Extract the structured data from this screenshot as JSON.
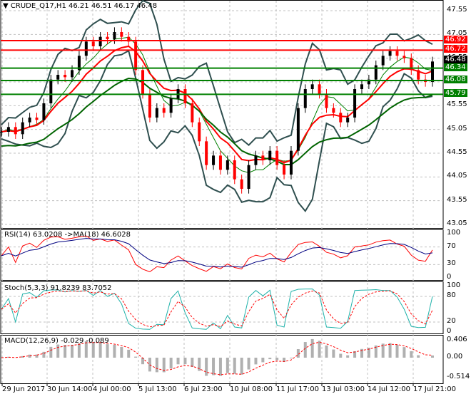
{
  "header": {
    "symbol": "CRUDE_Q17,H1",
    "ohlc": "46.21 46.51 46.17 46.48"
  },
  "price_axis": {
    "ticks": [
      "47.55",
      "47.05",
      "46.55",
      "46.05",
      "45.55",
      "45.05",
      "44.55",
      "44.05",
      "43.55",
      "43.05"
    ],
    "max": 47.55,
    "min": 43.05
  },
  "levels": [
    {
      "label": "46.92",
      "value": 46.92,
      "color": "#ff0000"
    },
    {
      "label": "46.72",
      "value": 46.72,
      "color": "#ff0000"
    },
    {
      "label": "46.34",
      "value": 46.34,
      "color": "#008000"
    },
    {
      "label": "46.08",
      "value": 46.08,
      "color": "#008000"
    },
    {
      "label": "45.79",
      "value": 45.79,
      "color": "#008000"
    }
  ],
  "current_price": {
    "label": "46.48",
    "value": 46.48
  },
  "rsi": {
    "title": "RSI(14) 63.0208  ->MA(18) 46.6028",
    "ticks": [
      "100",
      "70",
      "30",
      "0"
    ]
  },
  "stoch": {
    "title": "Stoch(5,3,3) 91.8239 83.7052",
    "ticks": [
      "100",
      "80",
      "20",
      "0"
    ]
  },
  "macd": {
    "title": "MACD(12,26,9) -0.029 -0.089",
    "ticks": [
      "0.406",
      "0.00",
      "-0.514"
    ]
  },
  "time_axis": [
    "29 Jun 2017",
    "30 Jun 14:00",
    "4 Jul 00:00",
    "5 Jul 13:00",
    "6 Jul 23:00",
    "10 Jul 08:00",
    "11 Jul 17:00",
    "13 Jul 03:00",
    "14 Jul 12:00",
    "17 Jul 21:00"
  ],
  "chart_data": {
    "type": "candlestick",
    "closes": [
      45.0,
      45.1,
      44.95,
      45.2,
      45.3,
      45.25,
      45.6,
      46.1,
      46.2,
      46.15,
      46.3,
      46.6,
      46.9,
      46.8,
      47.0,
      46.95,
      47.1,
      47.0,
      46.9,
      46.3,
      45.8,
      45.3,
      45.5,
      45.4,
      45.7,
      45.9,
      45.6,
      45.2,
      44.8,
      44.3,
      44.5,
      44.2,
      44.4,
      44.0,
      43.8,
      44.3,
      44.5,
      44.4,
      44.6,
      44.3,
      44.1,
      44.6,
      45.5,
      45.9,
      46.0,
      45.8,
      45.5,
      45.4,
      45.2,
      45.3,
      45.9,
      46.0,
      46.1,
      46.4,
      46.6,
      46.7,
      46.6,
      46.55,
      46.3,
      46.1,
      46.05,
      46.48
    ],
    "colors": {
      "up": "#000000",
      "down": "#ff0000",
      "ma_fast": "#ff0000",
      "ma_slow": "#006400",
      "bands": "#2f4f4f"
    }
  }
}
